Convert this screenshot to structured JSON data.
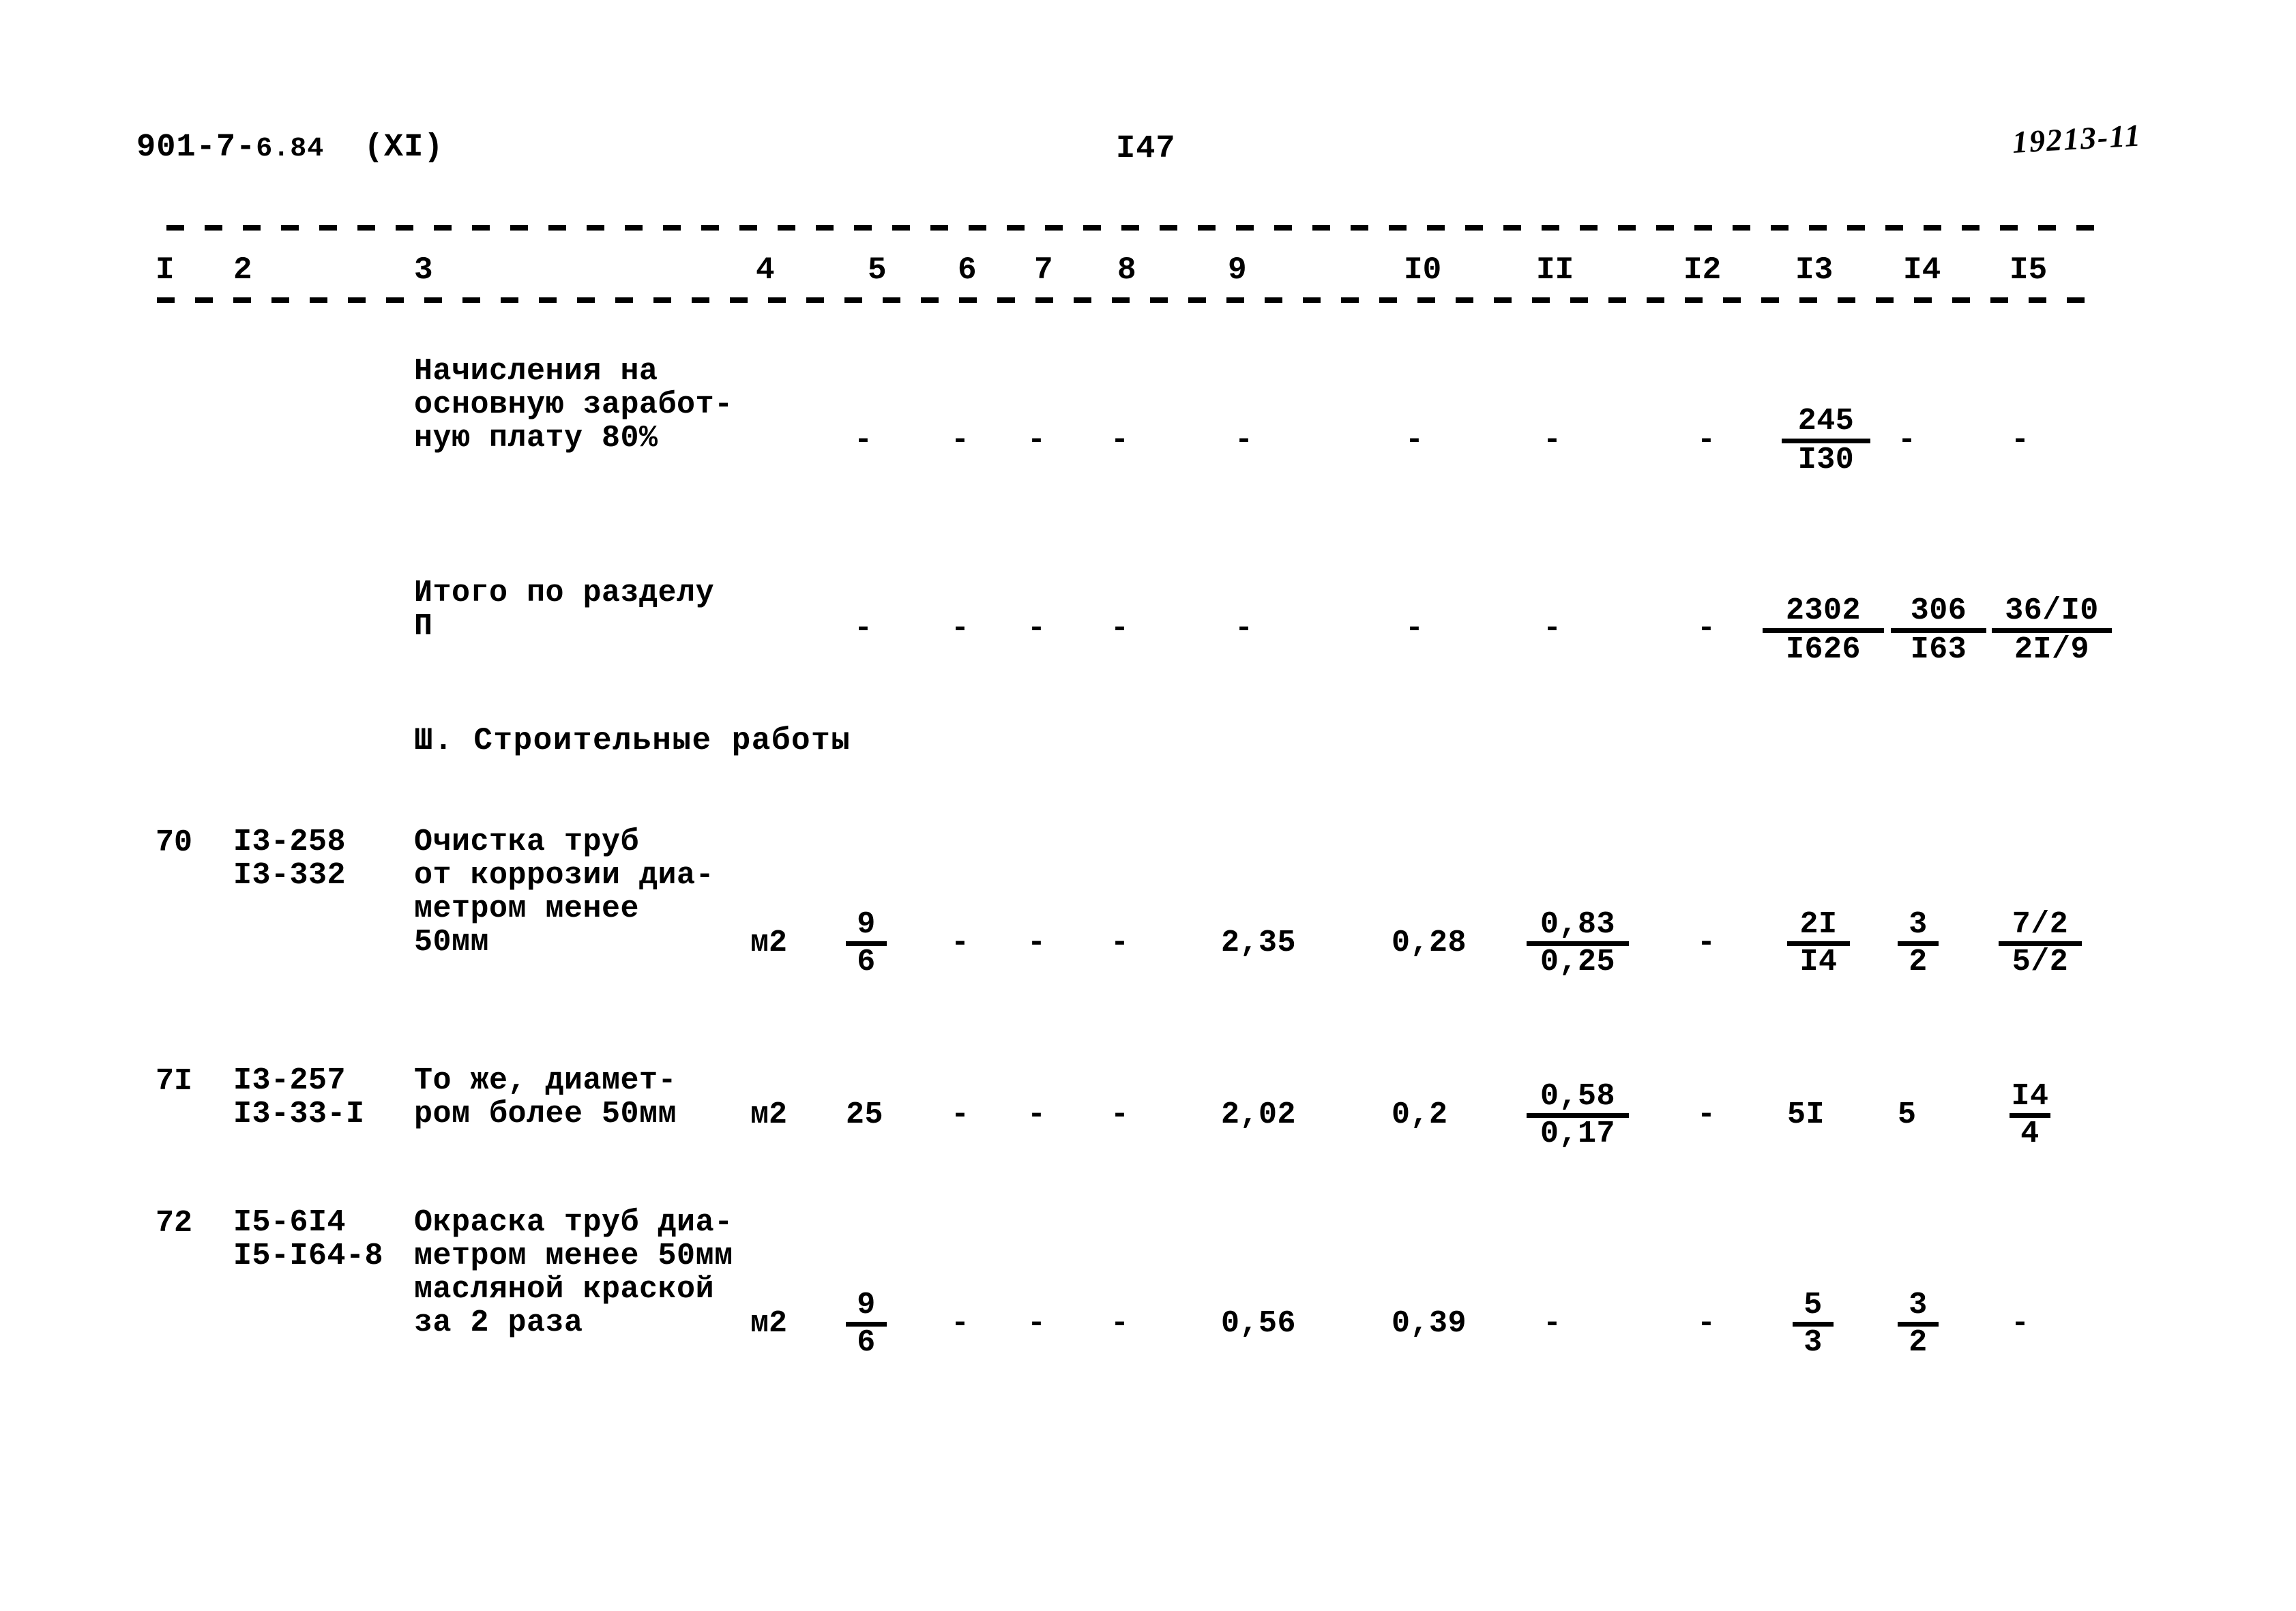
{
  "header": {
    "document_code": "901-7-",
    "document_code_small": "6.84",
    "revision": "(XI)",
    "page_number": "I47",
    "handwritten_mark": "19213-11"
  },
  "table": {
    "column_numbers": [
      "I",
      "2",
      "3",
      "4",
      "5",
      "6",
      "7",
      "8",
      "9",
      "I0",
      "II",
      "I2",
      "I3",
      "I4",
      "I5"
    ],
    "rows": [
      {
        "id": "row-nachisleniya",
        "row_number": "",
        "codes": [],
        "description": [
          "Начисления на",
          "основную заработ-",
          "ную плату 80%"
        ],
        "unit": "",
        "c4": "-",
        "c5": "-",
        "c6": "-",
        "c7": "-",
        "c8": "-",
        "c9": "-",
        "c10": "-",
        "c11": "-",
        "c12": "-",
        "c13_num": "245",
        "c13_den": "I30",
        "c14": "-",
        "c15": "-"
      },
      {
        "id": "row-itogo",
        "row_number": "",
        "codes": [],
        "description": [
          "Итого по разделу",
          "П"
        ],
        "unit": "",
        "c4": "-",
        "c5": "-",
        "c6": "-",
        "c7": "-",
        "c8": "-",
        "c9": "-",
        "c10": "-",
        "c11": "-",
        "c12": "-",
        "c13_num": "2302",
        "c13_den": "I626",
        "c14_num": "306",
        "c14_den": "I63",
        "c15_num": "36/I0",
        "c15_den": "2I/9"
      },
      {
        "id": "row-70",
        "row_number": "70",
        "codes": [
          "I3-258",
          "I3-332"
        ],
        "description": [
          "Очистка труб",
          "от коррозии диа-",
          "метром менее",
          "50мм"
        ],
        "unit": "м2",
        "c4_num": "9",
        "c4_den": "6",
        "c5": "-",
        "c6": "-",
        "c7": "-",
        "c8": "2,35",
        "c9": "0,28",
        "c10_num": "0,83",
        "c10_den": "0,25",
        "c11": "-",
        "c13_num": "2I",
        "c13_den": "I4",
        "c14_num": "3",
        "c14_den": "2",
        "c15_num": "7/2",
        "c15_den": "5/2"
      },
      {
        "id": "row-71",
        "row_number": "7I",
        "codes": [
          "I3-257",
          "I3-33-I"
        ],
        "description": [
          "То же, диамет-",
          "ром более 50мм"
        ],
        "unit": "м2",
        "c4": "25",
        "c5": "-",
        "c6": "-",
        "c7": "-",
        "c8": "2,02",
        "c9": "0,2",
        "c10_num": "0,58",
        "c10_den": "0,17",
        "c11": "-",
        "c13": "5I",
        "c14": "5",
        "c15_num": "I4",
        "c15_den": "4"
      },
      {
        "id": "row-72",
        "row_number": "72",
        "codes": [
          "I5-6I4",
          "I5-I64-8"
        ],
        "description": [
          "Окраска труб диа-",
          "метром менее 50мм",
          "масляной краской",
          "за 2 раза"
        ],
        "unit": "м2",
        "c4_num": "9",
        "c4_den": "6",
        "c5": "-",
        "c6": "-",
        "c7": "-",
        "c8": "0,56",
        "c9": "0,39",
        "c10": "-",
        "c11": "-",
        "c13_num": "5",
        "c13_den": "3",
        "c14_num": "3",
        "c14_den": "2",
        "c15": "-"
      }
    ],
    "section_heading": "Ш. Строительные работы"
  },
  "colors": {
    "ink": "#000000",
    "paper": "#ffffff"
  }
}
